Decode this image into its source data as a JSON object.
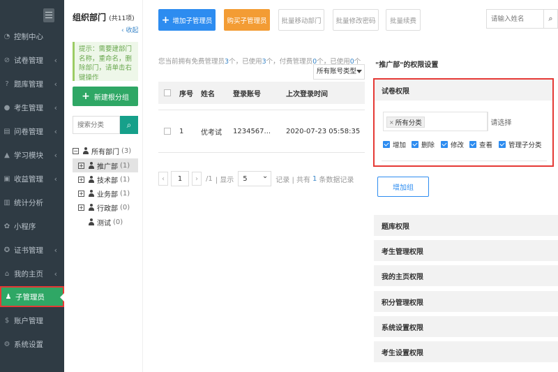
{
  "sidebar": {
    "items": [
      {
        "label": "控制中心",
        "icon": "dashboard-icon"
      },
      {
        "label": "试卷管理",
        "icon": "check-circle-icon"
      },
      {
        "label": "题库管理",
        "icon": "question-circle-icon"
      },
      {
        "label": "考生管理",
        "icon": "user-icon"
      },
      {
        "label": "问卷管理",
        "icon": "clipboard-icon"
      },
      {
        "label": "学习模块",
        "icon": "graduation-cap-icon"
      },
      {
        "label": "收益管理",
        "icon": "wallet-icon"
      },
      {
        "label": "统计分析",
        "icon": "chart-icon"
      },
      {
        "label": "小程序",
        "icon": "miniprogram-icon"
      },
      {
        "label": "证书管理",
        "icon": "certificate-icon"
      },
      {
        "label": "我的主页",
        "icon": "home-icon"
      },
      {
        "label": "子管理员",
        "icon": "sub-admin-icon"
      },
      {
        "label": "账户管理",
        "icon": "dollar-icon"
      },
      {
        "label": "系统设置",
        "icon": "gear-icon"
      }
    ]
  },
  "departments": {
    "title": "组织部门",
    "count": "(共11项)",
    "collapse": "收起",
    "tip": "提示：需要建部门名称，重命名，删除部门，请单击右键操作",
    "new_group": "新建根分组",
    "search_placeholder": "搜索分类",
    "tree": [
      {
        "label": "所有部门",
        "count": "(3)"
      },
      {
        "label": "推广部",
        "count": "(1)"
      },
      {
        "label": "技术部",
        "count": "(1)"
      },
      {
        "label": "业务部",
        "count": "(1)"
      },
      {
        "label": "行政部",
        "count": "(0)"
      },
      {
        "label": "测试",
        "count": "(0)"
      }
    ]
  },
  "toolbar": {
    "add_admin": "增加子管理员",
    "buy_admin": "购买子管理员",
    "batch_move": "批量移动部门",
    "batch_password": "批量修改密码",
    "batch_renew": "批量续费",
    "search_placeholder": "请输入姓名"
  },
  "admin_info": {
    "p1": "您当前拥有免费管理员",
    "free": "3",
    "p2": "个，已使用",
    "used": "3",
    "p3": "个，付费管理员",
    "paid": "0",
    "p4": "个，已使用",
    "paid_used": "0",
    "p5": "个"
  },
  "account_type": "所有账号类型",
  "table": {
    "headers": {
      "no": "序号",
      "name": "姓名",
      "account": "登录账号",
      "last_login": "上次登录时间"
    },
    "rows": [
      {
        "no": "1",
        "name": "优考试",
        "account": "1234567...",
        "last_login": "2020-07-23 05:58:35"
      }
    ]
  },
  "pager": {
    "page": "1",
    "total_pages": "/1",
    "show": "| 显示",
    "per_page": "5",
    "records_prefix": "记录 | 共有",
    "records": "1",
    "records_suffix": "条数据记录"
  },
  "permissions": {
    "title": "\"推广部\"的权限设置",
    "exam_section": "试卷权限",
    "tag": "所有分类",
    "choose": "请选择",
    "checks": [
      "增加",
      "删除",
      "修改",
      "查看",
      "管理子分类"
    ],
    "add_group": "增加组",
    "sections": [
      "题库权限",
      "考生管理权限",
      "我的主页权限",
      "积分管理权限",
      "系统设置权限",
      "考生设置权限"
    ]
  }
}
